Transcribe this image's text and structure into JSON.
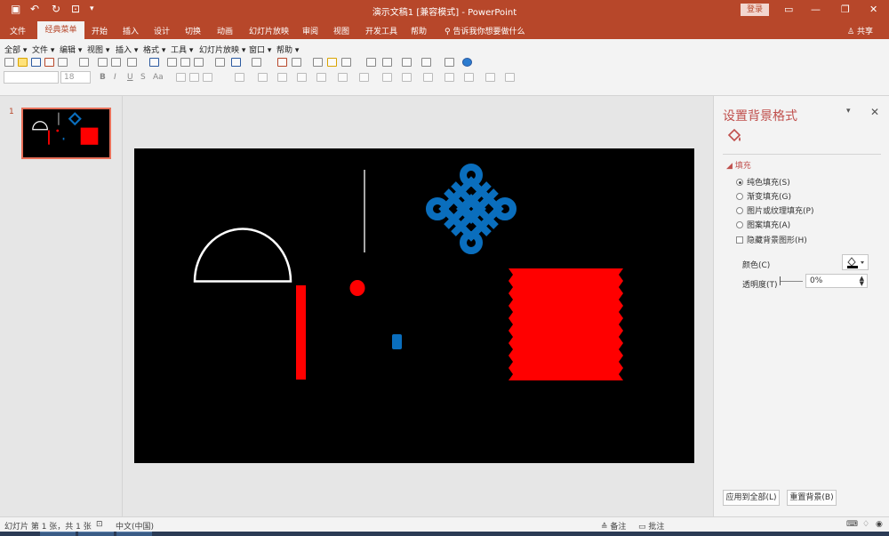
{
  "title_bar": {
    "document_title": "演示文稿1 [兼容模式] - PowerPoint",
    "login_label": "登录"
  },
  "ribbon_tabs": [
    {
      "label": "文件"
    },
    {
      "label": "经典菜单"
    },
    {
      "label": "开始"
    },
    {
      "label": "插入"
    },
    {
      "label": "设计"
    },
    {
      "label": "切换"
    },
    {
      "label": "动画"
    },
    {
      "label": "幻灯片放映"
    },
    {
      "label": "审阅"
    },
    {
      "label": "视图"
    },
    {
      "label": "开发工具"
    },
    {
      "label": "帮助"
    }
  ],
  "tell_me": "告诉我你想要做什么",
  "share": "共享",
  "classic_menus": [
    {
      "label": "全部 ▾"
    },
    {
      "label": "文件 ▾"
    },
    {
      "label": "编辑 ▾"
    },
    {
      "label": "视图 ▾"
    },
    {
      "label": "插入 ▾"
    },
    {
      "label": "格式 ▾"
    },
    {
      "label": "工具 ▾"
    },
    {
      "label": "幻灯片放映 ▾"
    },
    {
      "label": "窗口 ▾"
    },
    {
      "label": "帮助 ▾"
    }
  ],
  "font": {
    "name": "",
    "size": "18"
  },
  "format_buttons": {
    "bold": "B",
    "italic": "I",
    "underline": "U",
    "strike": "S",
    "font_size": "Aa"
  },
  "slide_pane": {
    "slide_number": "1"
  },
  "format_panel": {
    "title": "设置背景格式",
    "section": "填充",
    "options": [
      {
        "label": "纯色填充(S)",
        "selected": true
      },
      {
        "label": "渐变填充(G)",
        "selected": false
      },
      {
        "label": "图片或纹理填充(P)",
        "selected": false
      },
      {
        "label": "图案填充(A)",
        "selected": false
      }
    ],
    "hide_background": {
      "label": "隐藏背景图形(H)",
      "checked": false
    },
    "color_label": "颜色(C)",
    "transparency_label": "透明度(T)",
    "transparency_value": "0%",
    "apply_all_label": "应用到全部(L)",
    "reset_label": "重置背景(B)"
  },
  "status_bar": {
    "slide_info": "幻灯片 第 1 张，共 1 张",
    "language": "中文(中国)",
    "notes": "备注",
    "comments": "批注"
  },
  "colors": {
    "accent": "#b7472a",
    "slide_bg": "#000000",
    "shape_red": "#ff0000",
    "shape_blue": "#0a6ebd"
  }
}
